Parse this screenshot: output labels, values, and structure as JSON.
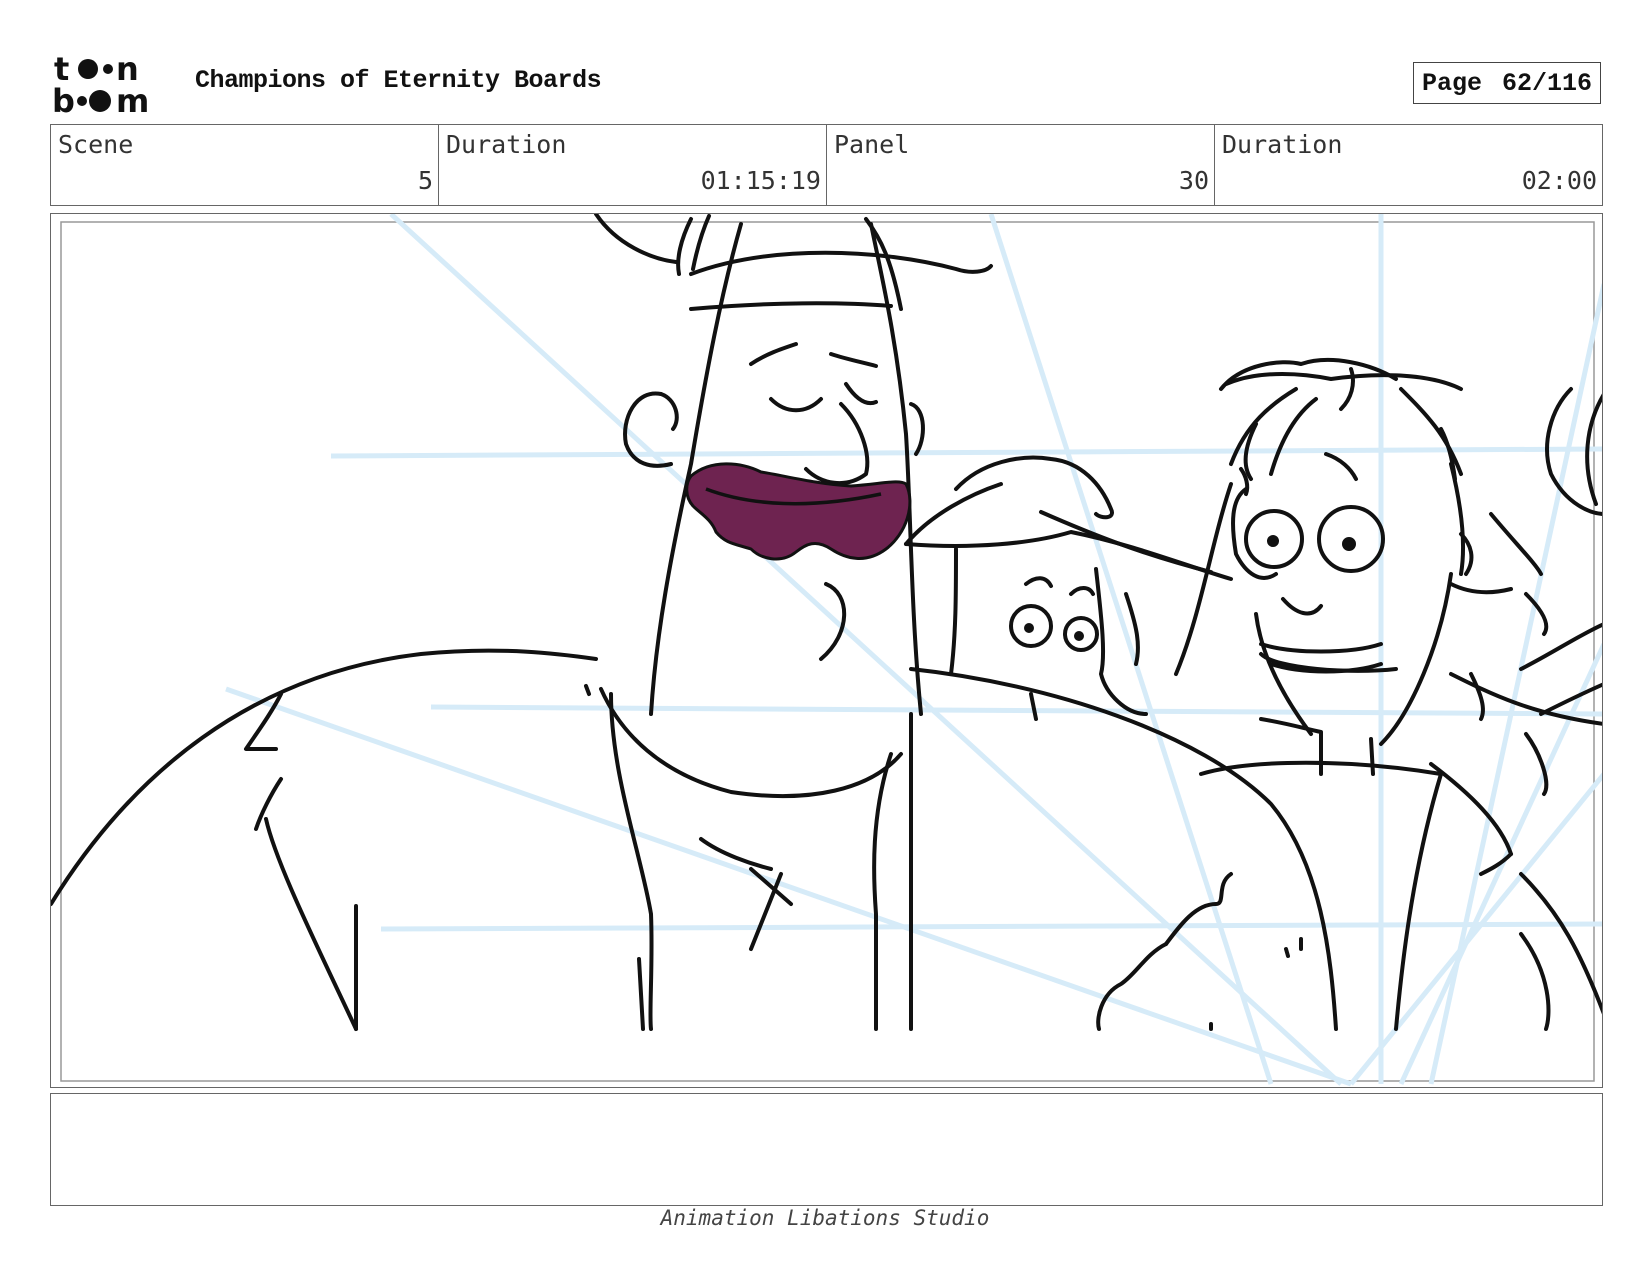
{
  "header": {
    "logo_text": "toon boom",
    "title": "Champions of Eternity Boards",
    "page_label": "Page",
    "page_value": "62/116"
  },
  "info": {
    "scene_label": "Scene",
    "scene_value": "5",
    "scene_duration_label": "Duration",
    "scene_duration_value": "01:15:19",
    "panel_label": "Panel",
    "panel_value": "30",
    "panel_duration_label": "Duration",
    "panel_duration_value": "02:00"
  },
  "panel": {
    "mouth_color": "#6e2350",
    "guide_color": "#d6ebf8"
  },
  "notes": {
    "text": ""
  },
  "footer": {
    "studio": "Animation Libations Studio"
  }
}
